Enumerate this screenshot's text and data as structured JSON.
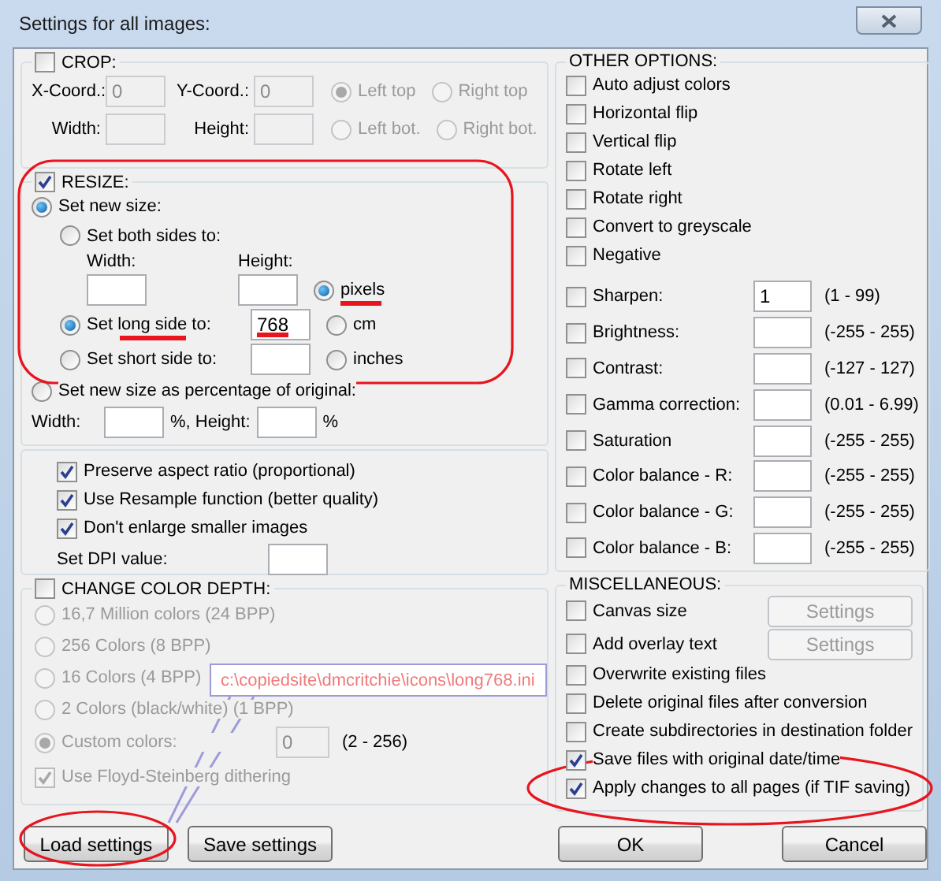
{
  "window": {
    "title": "Settings for all images:"
  },
  "crop": {
    "label": "CROP:",
    "checked": false,
    "disabled": true,
    "x": {
      "label": "X-Coord.:",
      "value": "0"
    },
    "y": {
      "label": "Y-Coord.:",
      "value": "0"
    },
    "width": {
      "label": "Width:"
    },
    "height": {
      "label": "Height:"
    },
    "anchors": [
      {
        "label": "Left top",
        "selected": true
      },
      {
        "label": "Right top",
        "selected": false
      },
      {
        "label": "Left bot.",
        "selected": false
      },
      {
        "label": "Right bot.",
        "selected": false
      }
    ]
  },
  "resize": {
    "label": "RESIZE:",
    "checked": true,
    "new_size": {
      "label": "Set new size:",
      "selected": true
    },
    "both_sides": {
      "label": "Set both sides to:",
      "selected": false,
      "width_label": "Width:",
      "height_label": "Height:"
    },
    "long_side": {
      "label": "Set long side to:",
      "selected": true,
      "value": "768"
    },
    "short_side": {
      "label": "Set short side to:",
      "selected": false
    },
    "units": [
      {
        "label": "pixels",
        "selected": true
      },
      {
        "label": "cm",
        "selected": false
      },
      {
        "label": "inches",
        "selected": false
      }
    ],
    "percentage": {
      "label": "Set new size as percentage of original:",
      "selected": false,
      "width_label": "Width:",
      "width_suffix": "%, Height:",
      "height_suffix": "%"
    }
  },
  "options": [
    {
      "label": "Preserve aspect ratio (proportional)",
      "checked": true
    },
    {
      "label": "Use Resample function (better quality)",
      "checked": true
    },
    {
      "label": "Don't enlarge smaller images",
      "checked": true
    }
  ],
  "dpi": {
    "label": "Set DPI value:"
  },
  "color_depth": {
    "label": "CHANGE COLOR DEPTH:",
    "checked": false,
    "disabled": true,
    "choices": [
      {
        "label": "16,7 Million colors (24 BPP)",
        "selected": false
      },
      {
        "label": "256 Colors (8 BPP)",
        "selected": false
      },
      {
        "label": "16 Colors (4 BPP)",
        "selected": false
      },
      {
        "label": "2 Colors (black/white) (1 BPP)",
        "selected": false
      },
      {
        "label": "Custom colors:",
        "selected": true,
        "value": "0",
        "range": "(2 - 256)"
      }
    ],
    "dithering": {
      "label": "Use Floyd-Steinberg dithering",
      "checked": true
    }
  },
  "tooltip": {
    "text": "c:\\copiedsite\\dmcritchie\\icons\\long768.ini"
  },
  "left_buttons": [
    "Load settings",
    "Save settings"
  ],
  "other_options": {
    "title": "OTHER OPTIONS:",
    "toggles": [
      {
        "label": "Auto adjust colors",
        "checked": false
      },
      {
        "label": "Horizontal flip",
        "checked": false
      },
      {
        "label": "Vertical flip",
        "checked": false
      },
      {
        "label": "Rotate left",
        "checked": false
      },
      {
        "label": "Rotate right",
        "checked": false
      },
      {
        "label": "Convert to greyscale",
        "checked": false
      },
      {
        "label": "Negative",
        "checked": false
      }
    ],
    "adjustments": [
      {
        "label": "Sharpen:",
        "checked": false,
        "value": "1",
        "range": "(1  -  99)"
      },
      {
        "label": "Brightness:",
        "checked": false,
        "range": "(-255  -  255)"
      },
      {
        "label": "Contrast:",
        "checked": false,
        "range": "(-127  -  127)"
      },
      {
        "label": "Gamma correction:",
        "checked": false,
        "range": "(0.01  -  6.99)"
      },
      {
        "label": "Saturation",
        "checked": false,
        "range": "(-255  -  255)"
      },
      {
        "label": "Color balance - R:",
        "checked": false,
        "range": "(-255  -  255)"
      },
      {
        "label": "Color balance - G:",
        "checked": false,
        "range": "(-255  -  255)"
      },
      {
        "label": "Color balance - B:",
        "checked": false,
        "range": "(-255  -  255)"
      }
    ]
  },
  "misc": {
    "title": "MISCELLANEOUS:",
    "items": [
      {
        "label": "Canvas size",
        "checked": false,
        "button": {
          "label": "Settings",
          "disabled": true
        }
      },
      {
        "label": "Add overlay text",
        "checked": false,
        "button": {
          "label": "Settings",
          "disabled": true
        }
      },
      {
        "label": "Overwrite existing files",
        "checked": false
      },
      {
        "label": "Delete original files after conversion",
        "checked": false
      },
      {
        "label": "Create subdirectories in destination folder",
        "checked": false
      },
      {
        "label": "Save files with original date/time",
        "checked": true
      },
      {
        "label": "Apply changes to all pages (if TIF saving)",
        "checked": true
      }
    ]
  },
  "right_buttons": [
    "OK",
    "Cancel"
  ]
}
